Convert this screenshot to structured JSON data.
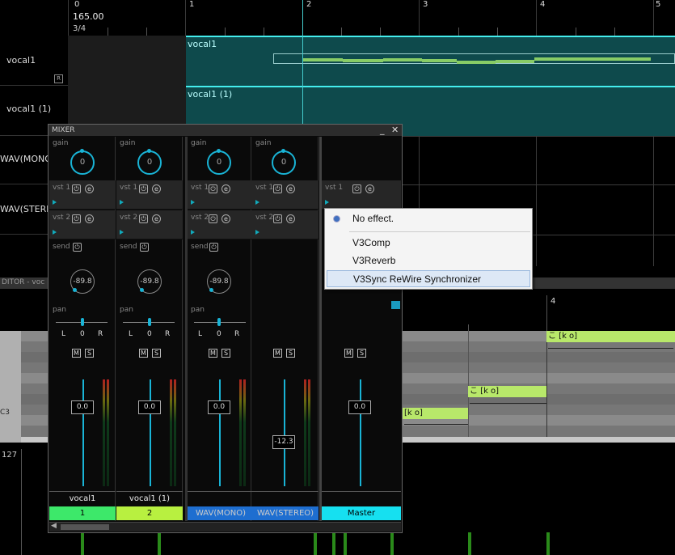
{
  "ruler": {
    "bars": [
      "0",
      "1",
      "2",
      "3",
      "4",
      "5"
    ],
    "tempo": "165.00",
    "time_signature": "3/4"
  },
  "tracks": [
    {
      "name": "vocal1",
      "button": "R"
    },
    {
      "name": "vocal1 (1)"
    },
    {
      "name": "WAV(MONO)"
    },
    {
      "name": "WAV(STEREO)"
    }
  ],
  "parts": [
    {
      "label": "vocal1"
    },
    {
      "label": "vocal1 (1)"
    }
  ],
  "editor": {
    "title": "DITOR - voc",
    "bar_label": "4",
    "key_label": "C3",
    "notes": [
      "[k o]",
      "こ [k o]",
      "こ [k o]"
    ],
    "velocity_max": "127"
  },
  "mixer": {
    "title": "MIXER",
    "labels": {
      "gain": "gain",
      "vst1": "vst 1",
      "vst2": "vst 2",
      "send": "send",
      "pan": "pan",
      "L": "L",
      "O": "0",
      "R": "R",
      "M": "M",
      "S": "S"
    },
    "channels": [
      {
        "name": "vocal1",
        "number": "1",
        "color": "#3de86a",
        "gain": "0",
        "send": "-89.8",
        "fader": "0.0"
      },
      {
        "name": "vocal1 (1)",
        "number": "2",
        "color": "#b8f040",
        "gain": "0",
        "send": "-89.8",
        "fader": "0.0"
      },
      {
        "name": "",
        "number": "WAV(MONO)",
        "color": "#1e6ed0",
        "gain": "0",
        "send": "-89.8",
        "fader": "0.0"
      },
      {
        "name": "",
        "number": "WAV(STEREO)",
        "color": "#1e6ed0",
        "gain": "0",
        "send": "",
        "fader": "-12.3"
      },
      {
        "name": "",
        "number": "Master",
        "color": "#16e0f0",
        "gain": "",
        "send": "",
        "fader": "0.0"
      }
    ]
  },
  "effect_menu": {
    "items": [
      "No effect.",
      "V3Comp",
      "V3Reverb",
      "V3Sync ReWire Synchronizer"
    ],
    "selected_index": 0,
    "highlighted_index": 3
  }
}
